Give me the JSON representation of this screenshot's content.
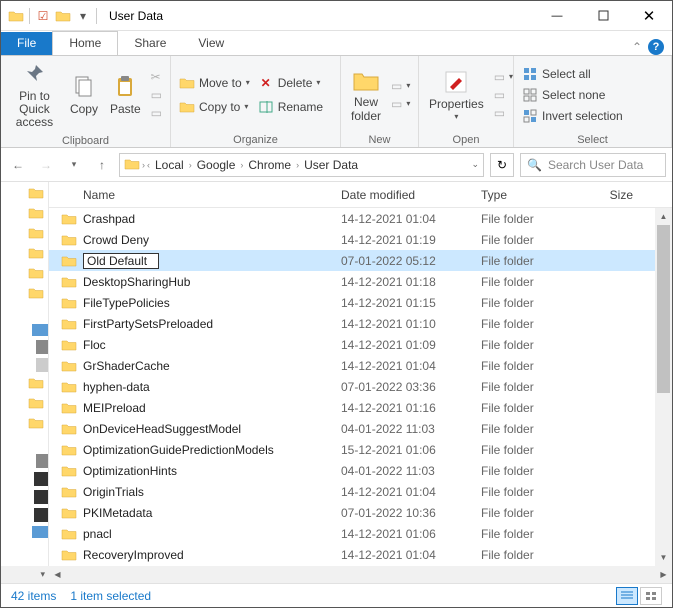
{
  "title": "User Data",
  "tabs": {
    "file": "File",
    "home": "Home",
    "share": "Share",
    "view": "View"
  },
  "ribbon": {
    "pin": "Pin to Quick\naccess",
    "copy": "Copy",
    "paste": "Paste",
    "clipboard_label": "Clipboard",
    "move_to": "Move to",
    "copy_to": "Copy to",
    "delete": "Delete",
    "rename": "Rename",
    "organize_label": "Organize",
    "new_folder": "New\nfolder",
    "new_label": "New",
    "properties": "Properties",
    "open_label": "Open",
    "select_all": "Select all",
    "select_none": "Select none",
    "invert_selection": "Invert selection",
    "select_label": "Select"
  },
  "breadcrumbs": [
    "Local",
    "Google",
    "Chrome",
    "User Data"
  ],
  "search_placeholder": "Search User Data",
  "columns": {
    "name": "Name",
    "date": "Date modified",
    "type": "Type",
    "size": "Size"
  },
  "file_type": "File folder",
  "rows": [
    {
      "name": "Crashpad",
      "date": "14-12-2021 01:04",
      "selected": false,
      "rename": false
    },
    {
      "name": "Crowd Deny",
      "date": "14-12-2021 01:19",
      "selected": false,
      "rename": false
    },
    {
      "name": "Old Default",
      "date": "07-01-2022 05:12",
      "selected": true,
      "rename": true
    },
    {
      "name": "DesktopSharingHub",
      "date": "14-12-2021 01:18",
      "selected": false,
      "rename": false
    },
    {
      "name": "FileTypePolicies",
      "date": "14-12-2021 01:15",
      "selected": false,
      "rename": false
    },
    {
      "name": "FirstPartySetsPreloaded",
      "date": "14-12-2021 01:10",
      "selected": false,
      "rename": false
    },
    {
      "name": "Floc",
      "date": "14-12-2021 01:09",
      "selected": false,
      "rename": false
    },
    {
      "name": "GrShaderCache",
      "date": "14-12-2021 01:04",
      "selected": false,
      "rename": false
    },
    {
      "name": "hyphen-data",
      "date": "07-01-2022 03:36",
      "selected": false,
      "rename": false
    },
    {
      "name": "MEIPreload",
      "date": "14-12-2021 01:16",
      "selected": false,
      "rename": false
    },
    {
      "name": "OnDeviceHeadSuggestModel",
      "date": "04-01-2022 11:03",
      "selected": false,
      "rename": false
    },
    {
      "name": "OptimizationGuidePredictionModels",
      "date": "15-12-2021 01:06",
      "selected": false,
      "rename": false
    },
    {
      "name": "OptimizationHints",
      "date": "04-01-2022 11:03",
      "selected": false,
      "rename": false
    },
    {
      "name": "OriginTrials",
      "date": "14-12-2021 01:04",
      "selected": false,
      "rename": false
    },
    {
      "name": "PKIMetadata",
      "date": "07-01-2022 10:36",
      "selected": false,
      "rename": false
    },
    {
      "name": "pnacl",
      "date": "14-12-2021 01:06",
      "selected": false,
      "rename": false
    },
    {
      "name": "RecoveryImproved",
      "date": "14-12-2021 01:04",
      "selected": false,
      "rename": false
    }
  ],
  "status": {
    "items": "42 items",
    "selected": "1 item selected"
  }
}
